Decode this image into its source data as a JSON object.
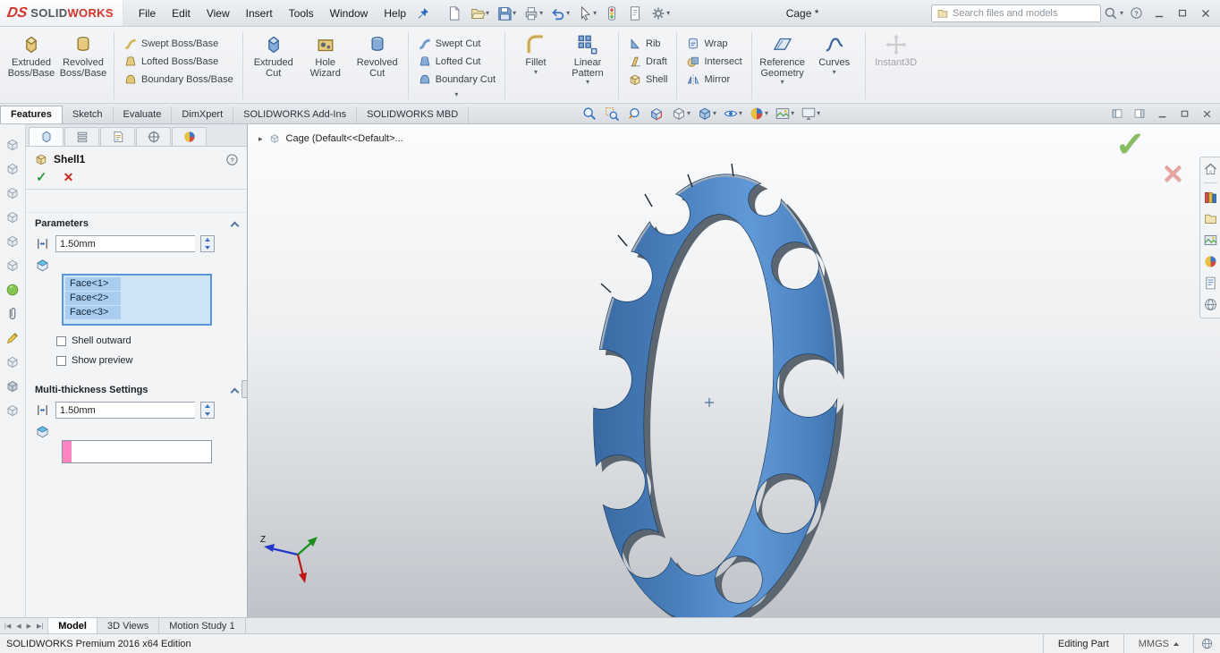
{
  "titlebar": {
    "logo": {
      "ds": "DS",
      "solid": "SOLID",
      "works": "WORKS"
    },
    "menus": [
      "File",
      "Edit",
      "View",
      "Insert",
      "Tools",
      "Window",
      "Help"
    ],
    "tools": [
      {
        "icon": "new-document",
        "caret": false
      },
      {
        "icon": "open",
        "caret": true
      },
      {
        "icon": "save",
        "caret": true
      },
      {
        "icon": "print",
        "caret": true
      },
      {
        "icon": "undo",
        "caret": true
      },
      {
        "icon": "select",
        "caret": true
      },
      {
        "icon": "rebuild",
        "caret": false
      },
      {
        "icon": "file-properties",
        "caret": false
      },
      {
        "icon": "options",
        "caret": true
      }
    ],
    "document_title": "Cage *",
    "search": {
      "placeholder": "Search files and models"
    }
  },
  "ribbon": {
    "groups": [
      {
        "buttons": [
          {
            "label": "Extruded Boss/Base",
            "icon": "extruded-boss",
            "size": "large"
          },
          {
            "label": "Revolved Boss/Base",
            "icon": "revolved-boss",
            "size": "large"
          }
        ]
      },
      {
        "buttons": [
          {
            "label": "Swept Boss/Base",
            "icon": "swept-boss",
            "size": "small"
          },
          {
            "label": "Lofted Boss/Base",
            "icon": "lofted-boss",
            "size": "small"
          },
          {
            "label": "Boundary Boss/Base",
            "icon": "boundary-boss",
            "size": "small"
          }
        ]
      },
      {
        "buttons": [
          {
            "label": "Extruded Cut",
            "icon": "extruded-cut",
            "size": "large"
          },
          {
            "label": "Hole Wizard",
            "icon": "hole-wizard",
            "size": "large"
          },
          {
            "label": "Revolved Cut",
            "icon": "revolved-cut",
            "size": "large"
          }
        ]
      },
      {
        "caret_below": true,
        "buttons": [
          {
            "label": "Swept Cut",
            "icon": "swept-cut",
            "size": "small"
          },
          {
            "label": "Lofted Cut",
            "icon": "lofted-cut",
            "size": "small"
          },
          {
            "label": "Boundary Cut",
            "icon": "boundary-cut",
            "size": "small"
          }
        ]
      },
      {
        "buttons": [
          {
            "label": "Fillet",
            "icon": "fillet",
            "size": "large",
            "caret": true
          },
          {
            "label": "Linear Pattern",
            "icon": "linear-pattern",
            "size": "large",
            "caret": true
          }
        ]
      },
      {
        "buttons": [
          {
            "label": "Rib",
            "icon": "rib",
            "size": "small"
          },
          {
            "label": "Draft",
            "icon": "draft",
            "size": "small"
          },
          {
            "label": "Shell",
            "icon": "shell",
            "size": "small"
          }
        ]
      },
      {
        "buttons": [
          {
            "label": "Wrap",
            "icon": "wrap",
            "size": "small"
          },
          {
            "label": "Intersect",
            "icon": "intersect",
            "size": "small"
          },
          {
            "label": "Mirror",
            "icon": "mirror",
            "size": "small"
          }
        ]
      },
      {
        "buttons": [
          {
            "label": "Reference Geometry",
            "icon": "reference-geometry",
            "size": "large",
            "caret": true
          },
          {
            "label": "Curves",
            "icon": "curves",
            "size": "large",
            "caret": true
          }
        ]
      },
      {
        "buttons": [
          {
            "label": "Instant3D",
            "icon": "instant3d",
            "size": "large",
            "disabled": true
          }
        ]
      }
    ]
  },
  "tabbar": {
    "tabs": [
      "Features",
      "Sketch",
      "Evaluate",
      "DimXpert",
      "SOLIDWORKS Add-Ins",
      "SOLIDWORKS MBD"
    ],
    "active_tab": "Features",
    "view_tools": [
      {
        "icon": "zoom-to-fit",
        "caret": false
      },
      {
        "icon": "zoom-to-area",
        "caret": false
      },
      {
        "icon": "previous-view",
        "caret": false
      },
      {
        "icon": "section-view",
        "caret": false
      },
      {
        "icon": "view-orientation",
        "caret": true
      },
      {
        "icon": "display-style",
        "caret": true
      },
      {
        "icon": "hide-show-items",
        "caret": true
      },
      {
        "icon": "edit-appearance",
        "caret": true
      },
      {
        "icon": "apply-scene",
        "caret": true
      },
      {
        "icon": "view-settings",
        "caret": true
      }
    ]
  },
  "left_toolbar": {
    "icons": [
      "cube",
      "cube",
      "cube",
      "cube",
      "cube",
      "cube",
      "sphere-green",
      "clip",
      "pencil",
      "cube",
      "cube-dark",
      "cube"
    ]
  },
  "property_manager": {
    "manager_tabs": [
      "pm-tab-feature",
      "pm-tab-property",
      "pm-tab-configuration",
      "pm-tab-dimxpert",
      "pm-tab-display"
    ],
    "title": "Shell1",
    "parameters_title": "Parameters",
    "thickness_value": "1.50mm",
    "faces": [
      "Face<1>",
      "Face<2>",
      "Face<3>"
    ],
    "shell_outward_label": "Shell outward",
    "show_preview_label": "Show preview",
    "multi_title": "Multi-thickness Settings",
    "multi_thickness_value": "1.50mm"
  },
  "viewport": {
    "breadcrumb": "Cage  (Default<<Default>...",
    "axis_z_label": "Z"
  },
  "task_pane": {
    "icons": [
      "home",
      "design-library",
      "file-explorer",
      "view-palette",
      "appearances",
      "custom-properties",
      "globe"
    ]
  },
  "bottom_tabs": {
    "tabs": [
      "Model",
      "3D Views",
      "Motion Study 1"
    ],
    "active": "Model"
  },
  "statusbar": {
    "edition": "SOLIDWORKS Premium 2016 x64 Edition",
    "mode": "Editing Part",
    "units": "MMGS"
  },
  "colors": {
    "model_blue": "#4f87c7",
    "selection_blue": "#cde4f7",
    "selection_pink": "#ff85c2",
    "confirm_green": "#85bd60",
    "cancel_red": "#e7a49e",
    "accent_blue": "#2f6db8"
  }
}
